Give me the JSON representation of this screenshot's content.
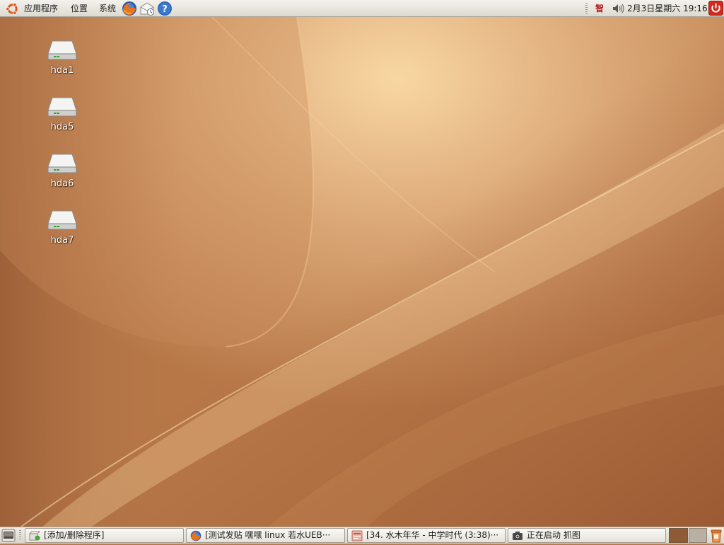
{
  "top_panel": {
    "menus": [
      "应用程序",
      "位置",
      "系统"
    ],
    "launchers": [
      "firefox-icon",
      "evolution-mail-icon",
      "help-icon"
    ],
    "tray": {
      "input_method": "智",
      "volume_icon": "speaker-icon",
      "clock": "2月3日星期六 19:16",
      "power_icon": "power-icon"
    }
  },
  "desktop": {
    "icons": [
      {
        "label": "hda1",
        "icon": "hard-drive-icon"
      },
      {
        "label": "hda5",
        "icon": "hard-drive-icon"
      },
      {
        "label": "hda6",
        "icon": "hard-drive-icon"
      },
      {
        "label": "hda7",
        "icon": "hard-drive-icon"
      }
    ]
  },
  "bottom_panel": {
    "show_desktop_icon": "show-desktop-icon",
    "tasks": [
      {
        "label": "[添加/删除程序]",
        "icon": "package-icon"
      },
      {
        "label": "[测试发贴 嘿嘿 linux 若水UEB···",
        "icon": "firefox-icon"
      },
      {
        "label": "[34. 水木年华 - 中学时代 (3:38)···",
        "icon": "music-player-icon"
      },
      {
        "label": "正在启动 抓图",
        "icon": "camera-icon"
      }
    ],
    "workspaces": 2,
    "trash_icon": "trash-icon"
  },
  "colors": {
    "wallpaper_dark": "#9a5c33",
    "wallpaper_light": "#f6d6a4",
    "panel": "#e9e6df",
    "power_red": "#d42a1e"
  }
}
